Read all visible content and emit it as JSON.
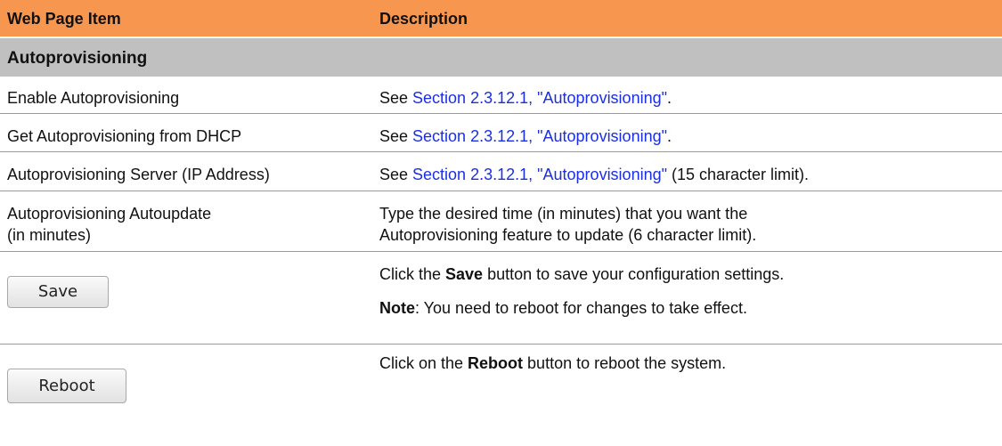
{
  "header": {
    "col1": "Web Page Item",
    "col2": "Description"
  },
  "section": {
    "title": "Autoprovisioning"
  },
  "rows": [
    {
      "item": "Enable Autoprovisioning",
      "prefix": "See ",
      "link": "Section 2.3.12.1, \"Autoprovisioning\"",
      "suffix": "."
    },
    {
      "item": "Get Autoprovisioning from DHCP",
      "prefix": "See ",
      "link": "Section 2.3.12.1, \"Autoprovisioning\"",
      "suffix": "."
    },
    {
      "item": "Autoprovisioning Server (IP Address)",
      "prefix": "See ",
      "link": "Section 2.3.12.1, \"Autoprovisioning\"",
      "suffix": " (15 character limit)."
    },
    {
      "item_line1": "Autoprovisioning Autoupdate",
      "item_line2": "(in minutes)",
      "desc_line1": "Type the desired time (in minutes) that you want the",
      "desc_line2": "Autoprovisioning feature to update (6 character limit)."
    }
  ],
  "save_row": {
    "button_label": "Save",
    "desc_prefix": "Click the ",
    "desc_bold": "Save",
    "desc_suffix": " button to save your configuration settings.",
    "note_bold": "Note",
    "note_text": ": You need to reboot for changes to take effect."
  },
  "reboot_row": {
    "button_label": "Reboot",
    "desc_prefix": "Click on the ",
    "desc_bold": "Reboot",
    "desc_suffix": " button to reboot the system."
  },
  "colors": {
    "header_bg": "#f7964f",
    "section_bg": "#c0c0c0",
    "link": "#1a2ee8"
  }
}
